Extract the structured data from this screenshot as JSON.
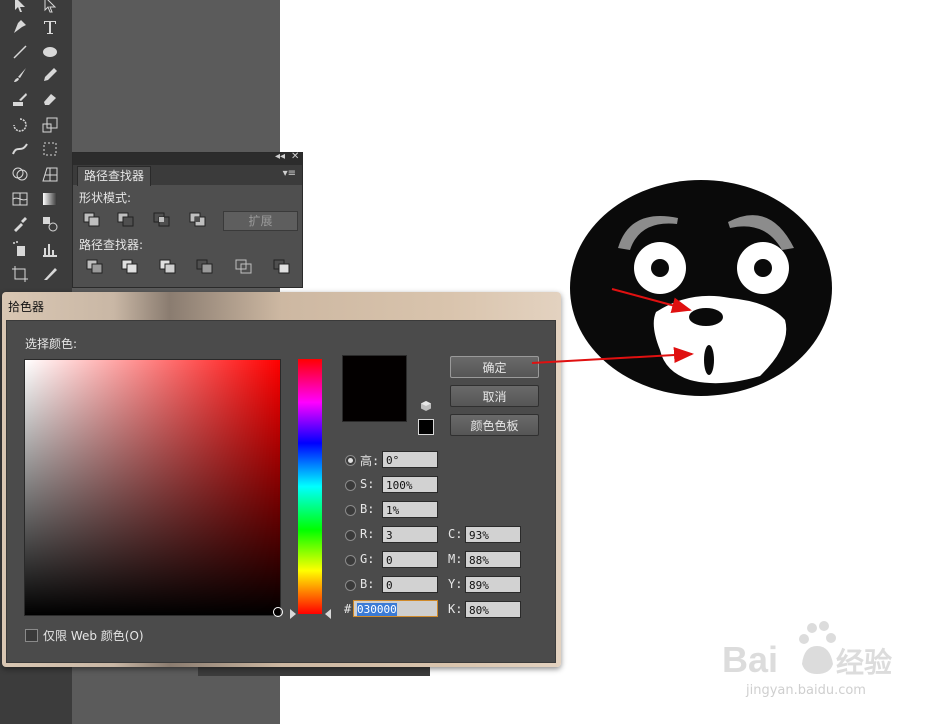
{
  "pathfinder": {
    "tab_label": "路径查找器",
    "shape_modes_label": "形状模式:",
    "pathfinders_label": "路径查找器:",
    "expand_label": "扩展"
  },
  "color_picker": {
    "title": "拾色器",
    "select_color_label": "选择颜色:",
    "ok_label": "确定",
    "cancel_label": "取消",
    "swatches_label": "颜色色板",
    "only_web_label": "仅限 Web 颜色(O)",
    "current_color": "#030000",
    "fields": {
      "h": {
        "label": "高:",
        "value": "0°"
      },
      "s": {
        "label": "S:",
        "value": "100%"
      },
      "b": {
        "label": "B:",
        "value": "1%"
      },
      "r": {
        "label": "R:",
        "value": "3"
      },
      "g": {
        "label": "G:",
        "value": "0"
      },
      "blue": {
        "label": "B:",
        "value": "0"
      },
      "hex": {
        "label": "#",
        "value": "030000"
      },
      "c": {
        "label": "C:",
        "value": "93%"
      },
      "m": {
        "label": "M:",
        "value": "88%"
      },
      "y": {
        "label": "Y:",
        "value": "89%"
      },
      "k": {
        "label": "K:",
        "value": "80%"
      }
    }
  },
  "watermark": {
    "brand": "Bai 经验",
    "url": "jingyan.baidu.com"
  },
  "colors": {
    "arrow_red": "#e01010",
    "face_black": "#0a0a0a",
    "eyebrow_gray": "#8c8c8c"
  },
  "toolbar_icons": [
    "selection-icon",
    "direct-selection-icon",
    "pen-icon",
    "type-icon",
    "line-icon",
    "ellipse-icon",
    "paintbrush-icon",
    "pencil-icon",
    "blob-brush-icon",
    "eraser-icon",
    "rotate-icon",
    "scale-icon",
    "width-icon",
    "free-transform-icon",
    "shape-builder-icon",
    "perspective-grid-icon",
    "mesh-icon",
    "gradient-icon",
    "eyedropper-icon",
    "blend-icon",
    "symbol-sprayer-icon",
    "graph-icon",
    "artboard-icon",
    "slice-icon"
  ]
}
